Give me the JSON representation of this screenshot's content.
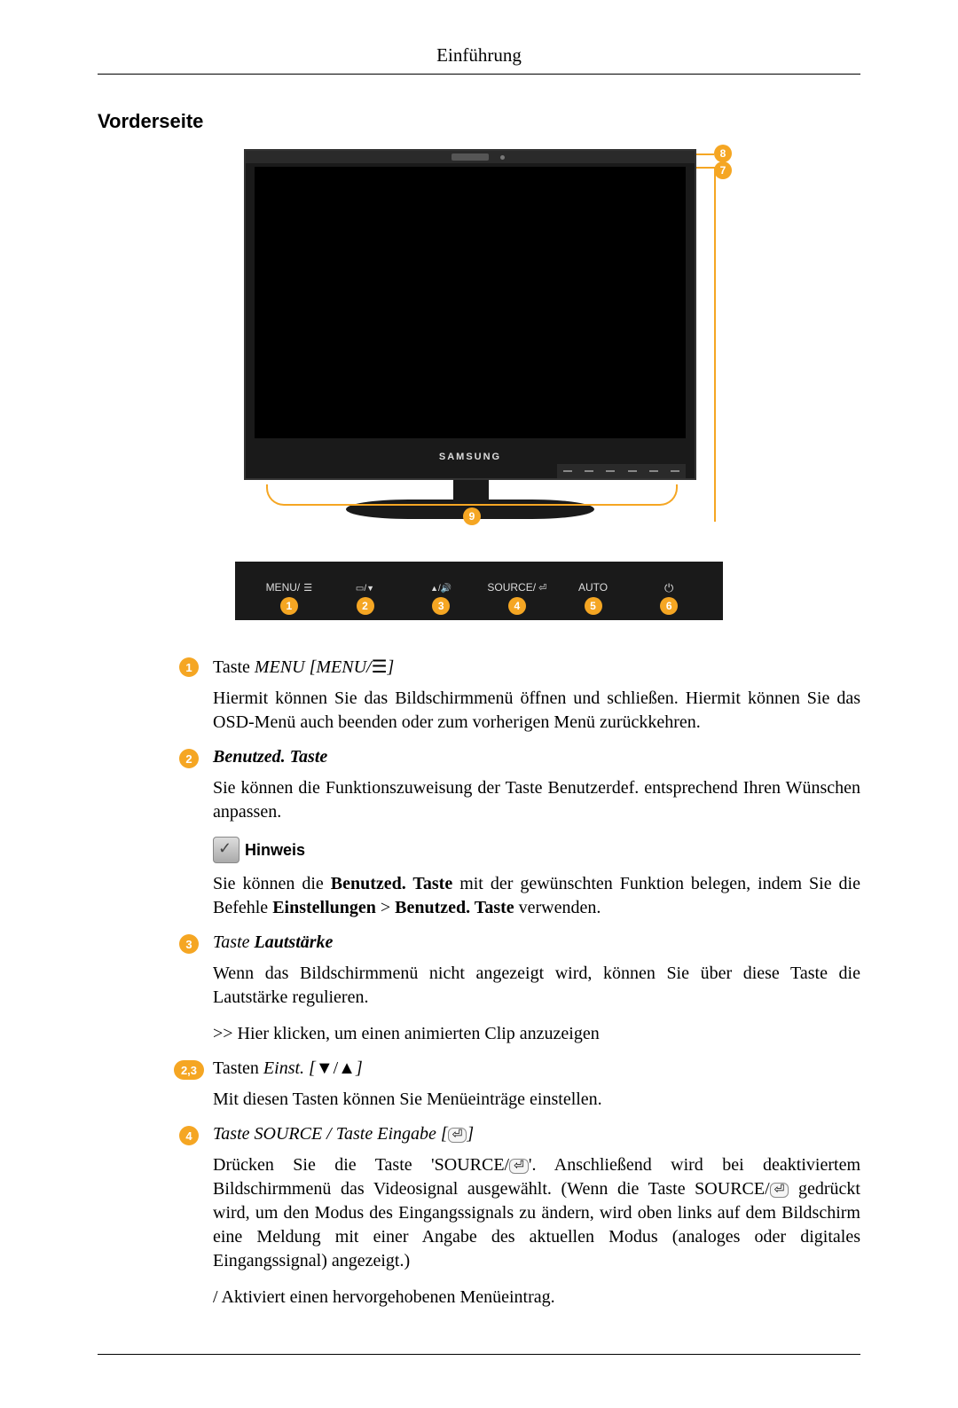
{
  "header": "Einführung",
  "section_title": "Vorderseite",
  "figure": {
    "brand": "SAMSUNG",
    "callouts": {
      "c7": "7",
      "c8": "8",
      "c9": "9"
    },
    "panel": {
      "b1": {
        "num": "1",
        "label": "MENU/"
      },
      "b2": {
        "num": "2",
        "label": ""
      },
      "b3": {
        "num": "3",
        "label": ""
      },
      "b4": {
        "num": "4",
        "label": "SOURCE/"
      },
      "b5": {
        "num": "5",
        "label": "AUTO"
      },
      "b6": {
        "num": "6",
        "label": ""
      }
    }
  },
  "entries": {
    "e1": {
      "num": "1",
      "title_pre": "Taste ",
      "title_ital": "MENU [MENU/",
      "title_sym": "☰",
      "title_post": "]",
      "body": "Hiermit können Sie das Bildschirmmenü öffnen und schließen. Hiermit können Sie das OSD-Menü auch beenden oder zum vorherigen Menü zurückkehren."
    },
    "e2": {
      "num": "2",
      "title": "Benutzed. Taste",
      "body1": "Sie können die Funktionszuweisung der Taste Benutzerdef. entsprechend Ihren Wünschen anpassen.",
      "hinweis": "Hinweis",
      "body2_a": "Sie können die ",
      "body2_b1": "Benutzed. Taste",
      "body2_c": " mit der gewünschten Funktion belegen, indem Sie die Befehle ",
      "body2_b2": "Einstellungen",
      "body2_d": " > ",
      "body2_b3": "Benutzed. Taste",
      "body2_e": " verwenden."
    },
    "e3": {
      "num": "3",
      "title_pre": "Taste ",
      "title_bold": "Lautstärke",
      "body1": "Wenn das Bildschirmmenü nicht angezeigt wird, können Sie über diese Taste die Lautstärke regulieren.",
      "body2": ">> Hier klicken, um einen animierten Clip anzuzeigen"
    },
    "e23": {
      "num": "2,3",
      "title_pre": "Tasten ",
      "title_ital": "Einst. [",
      "title_sym": "▼/▲",
      "title_post": "]",
      "body": "Mit diesen Tasten können Sie Menüeinträge einstellen."
    },
    "e4": {
      "num": "4",
      "title_ital": "Taste SOURCE / Taste Eingabe [",
      "title_sym": "⏎",
      "title_post": "]",
      "body1_a": "Drücken Sie die Taste 'SOURCE/",
      "body1_b": "'. Anschließend wird bei deaktiviertem Bildschirmmenü das Videosignal ausgewählt. (Wenn die Taste SOURCE/",
      "body1_c": " gedrückt wird, um den Modus des Eingangssignals zu ändern, wird oben links auf dem Bildschirm eine Meldung mit einer Angabe des aktuellen Modus (analoges oder digitales Eingangssignal) angezeigt.)",
      "body2": "/ Aktiviert einen hervorgehobenen Menüeintrag."
    }
  }
}
